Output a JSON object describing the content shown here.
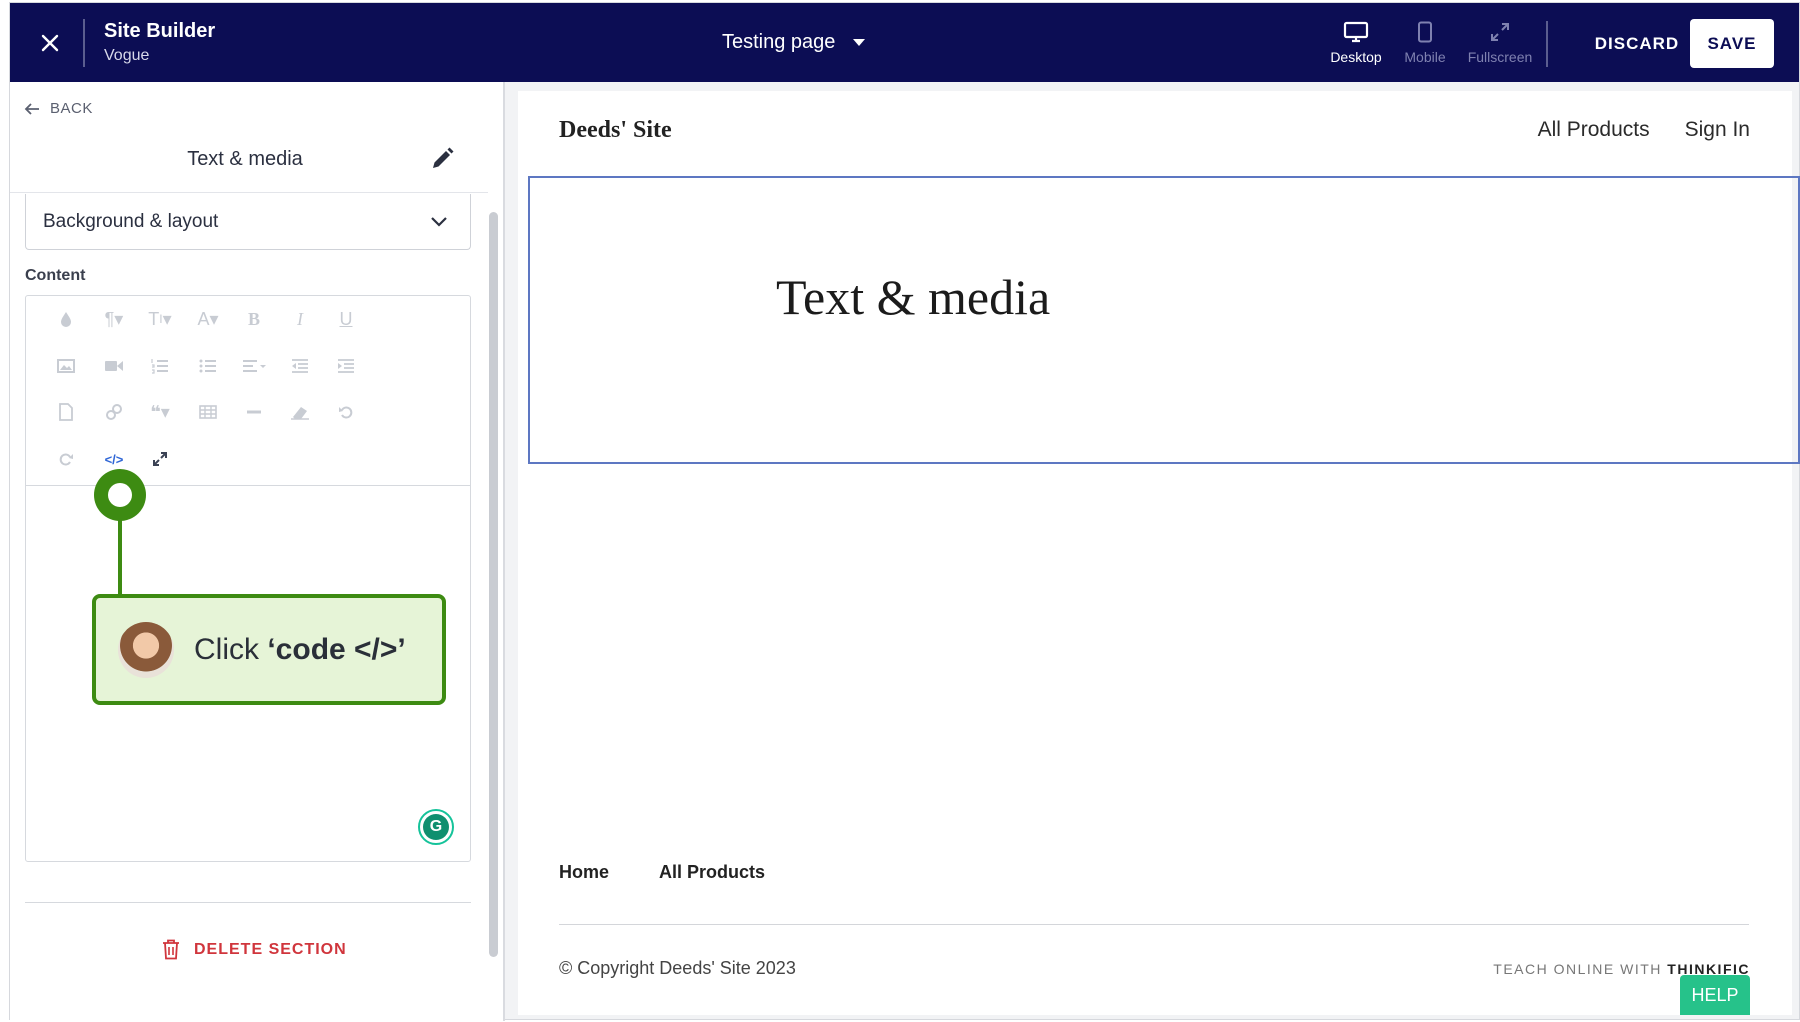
{
  "topbar": {
    "app_title": "Site Builder",
    "app_subtitle": "Vogue",
    "page_selector": "Testing page",
    "views": {
      "desktop": "Desktop",
      "mobile": "Mobile",
      "fullscreen": "Fullscreen"
    },
    "discard_label": "DISCARD",
    "save_label": "SAVE"
  },
  "panel": {
    "back_label": "BACK",
    "title": "Text & media",
    "background_layout": "Background & layout",
    "content_label": "Content",
    "delete_label": "DELETE SECTION"
  },
  "callout": {
    "prefix": "Click ",
    "target": "‘code </>’"
  },
  "preview": {
    "site_name": "Deeds' Site",
    "nav": [
      "All Products",
      "Sign In"
    ],
    "section_heading": "Text & media",
    "footer_nav": [
      "Home",
      "All Products"
    ],
    "copyright": "© Copyright Deeds' Site 2023",
    "teach_prefix": "TEACH ONLINE WITH ",
    "teach_brand": "THINKIFIC",
    "help_label": "HELP"
  },
  "colors": {
    "topbar_bg": "#0c0d54",
    "section_outline": "#5d77c2",
    "callout_green": "#3d8b12",
    "callout_bg": "#e6f4d7",
    "delete_red": "#d0353c",
    "help_green": "#26c28a"
  }
}
